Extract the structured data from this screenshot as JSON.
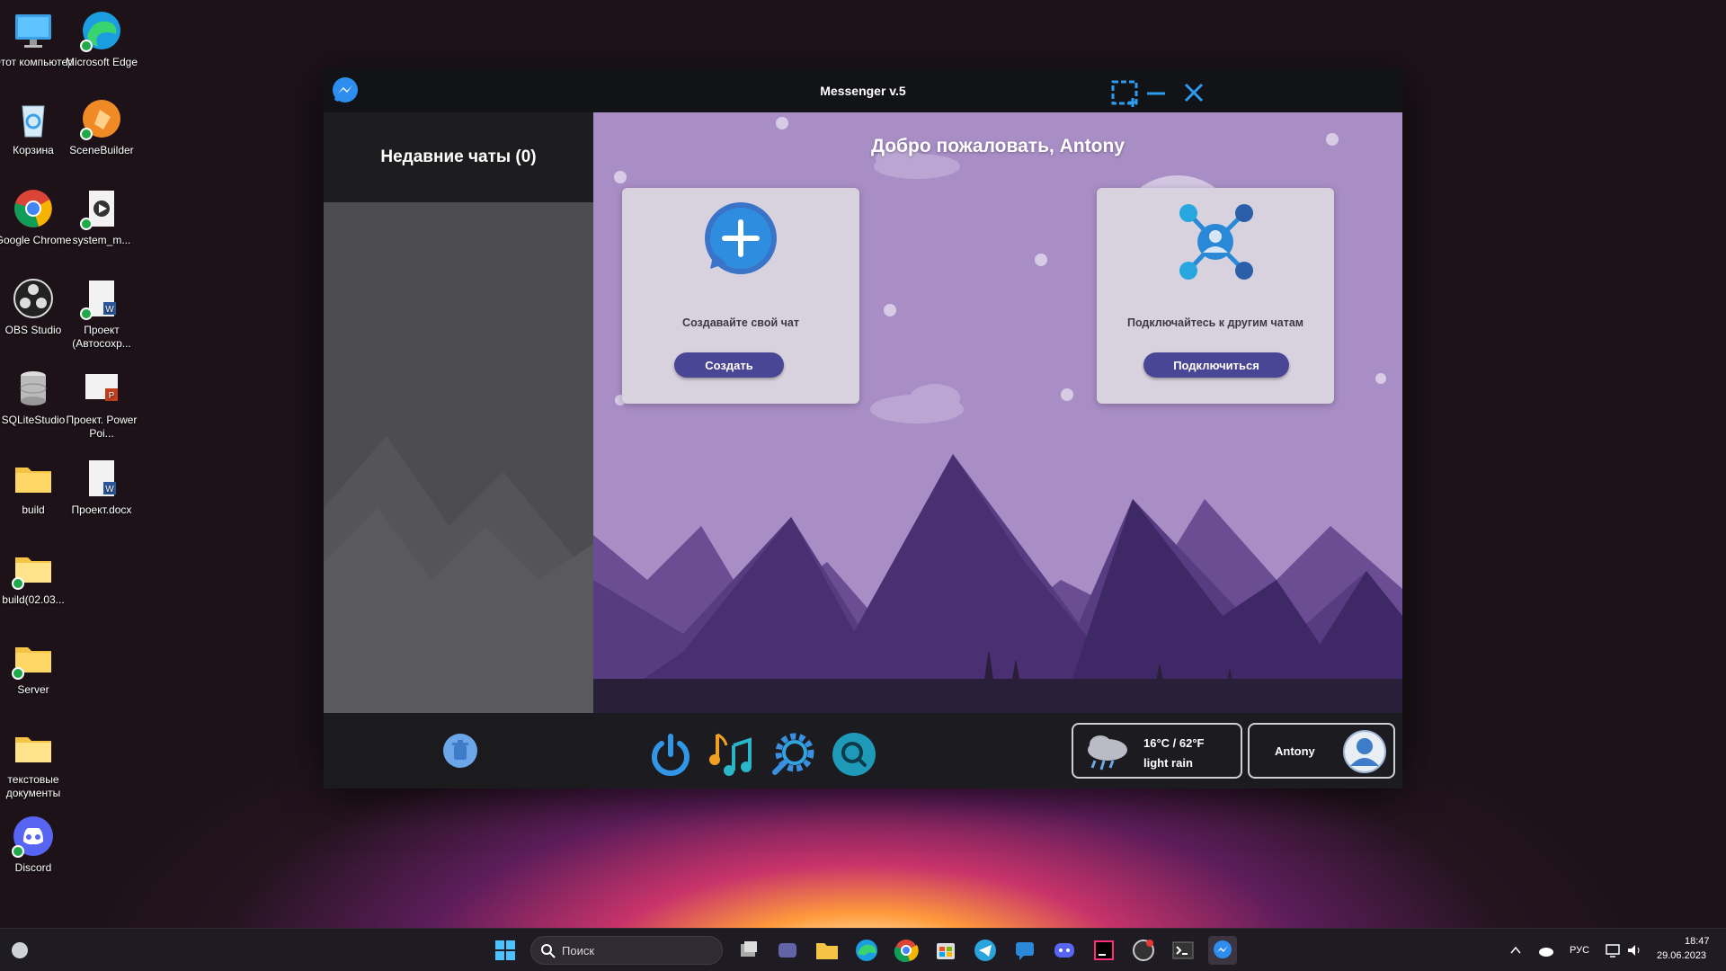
{
  "desktop": {
    "icons": [
      {
        "label": "Этот компьютер",
        "icon": "monitor-icon"
      },
      {
        "label": "Microsoft Edge",
        "icon": "edge-icon"
      },
      {
        "label": "Корзина",
        "icon": "recycle-bin-icon"
      },
      {
        "label": "SceneBuilder",
        "icon": "scenebuilder-icon"
      },
      {
        "label": "Google Chrome",
        "icon": "chrome-icon"
      },
      {
        "label": "system_m...",
        "icon": "video-file-icon"
      },
      {
        "label": "OBS Studio",
        "icon": "obs-icon"
      },
      {
        "label": "Проект (Автосохр...",
        "icon": "word-file-icon"
      },
      {
        "label": "SQLiteStudio",
        "icon": "database-icon"
      },
      {
        "label": "Проект. Power Poi...",
        "icon": "powerpoint-file-icon"
      },
      {
        "label": "build",
        "icon": "folder-icon"
      },
      {
        "label": "Проект.docx",
        "icon": "word-file-icon"
      },
      {
        "label": "build(02.03...",
        "icon": "folder-icon"
      },
      {
        "label": "Server",
        "icon": "folder-icon"
      },
      {
        "label": "текстовые документы",
        "icon": "folder-icon"
      },
      {
        "label": "Discord",
        "icon": "discord-icon"
      }
    ]
  },
  "window": {
    "title": "Messenger v.5",
    "sidebar": {
      "header": "Недавние чаты (0)"
    },
    "main": {
      "welcome": "Добро пожаловать, Antony",
      "create_card": {
        "text": "Создавайте свой чат",
        "button": "Создать"
      },
      "connect_card": {
        "text": "Подключайтесь к другим чатам",
        "button": "Подключиться"
      }
    },
    "bottom": {
      "weather": {
        "temp": "16°C / 62°F",
        "desc": "light rain"
      },
      "user": {
        "name": "Antony"
      }
    }
  },
  "taskbar": {
    "search_placeholder": "Поиск",
    "lang": "РУС",
    "time": "18:47",
    "date": "29.06.2023"
  },
  "colors": {
    "accent_button": "#4a4696",
    "main_bg": "#a98ec6",
    "mountain_dark": "#4a2f72"
  }
}
